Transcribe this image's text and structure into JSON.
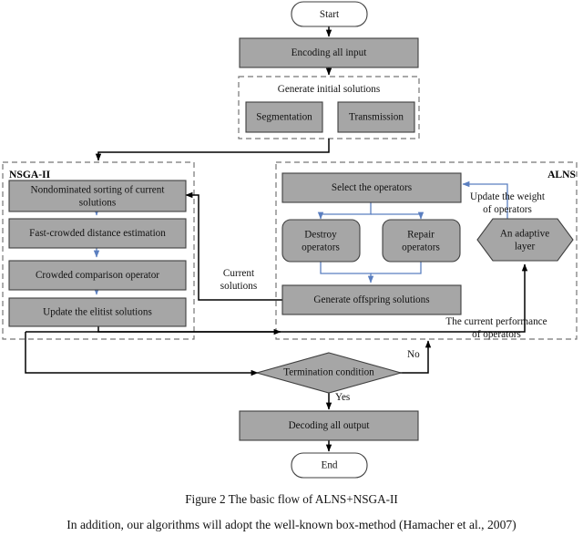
{
  "figure": {
    "caption": "Figure 2 The basic flow of ALNS+NSGA-II",
    "body_text": "In addition, our algorithms will adopt the well-known box-method (Hamacher et al., 2007)"
  },
  "colors": {
    "node_fill": "#a6a6a6",
    "node_stroke": "#3f3f3f",
    "terminator_fill": "#ffffff",
    "group_dash": "#767676",
    "arrow_black": "#000000",
    "arrow_blue": "#5b7fc0"
  },
  "nodes": {
    "start": "Start",
    "encoding": "Encoding all input",
    "segmentation": "Segmentation",
    "transmission": "Transmission",
    "nsga_box1_line1": "Nondominated sorting of current",
    "nsga_box1_line2": "solutions",
    "nsga_box2": "Fast-crowded distance estimation",
    "nsga_box3": "Crowded comparison operator",
    "nsga_box4": "Update the elitist solutions",
    "select_operators": "Select the operators",
    "destroy_line1": "Destroy",
    "destroy_line2": "operators",
    "repair_line1": "Repair",
    "repair_line2": "operators",
    "generate_offspring": "Generate offspring solutions",
    "adaptive_line1": "An adaptive",
    "adaptive_line2": "layer",
    "termination": "Termination condition",
    "decoding": "Decoding all output",
    "end": "End"
  },
  "groups": {
    "initial_solutions": "Generate initial solutions",
    "nsga2": "NSGA-II",
    "alns": "ALNS"
  },
  "edge_labels": {
    "current_line1": "Current",
    "current_line2": "solutions",
    "update_weight_line1": "Update the weight",
    "update_weight_line2": "of operators",
    "performance_line1": "The current performance",
    "performance_line2": "of operators",
    "no": "No",
    "yes": "Yes"
  }
}
